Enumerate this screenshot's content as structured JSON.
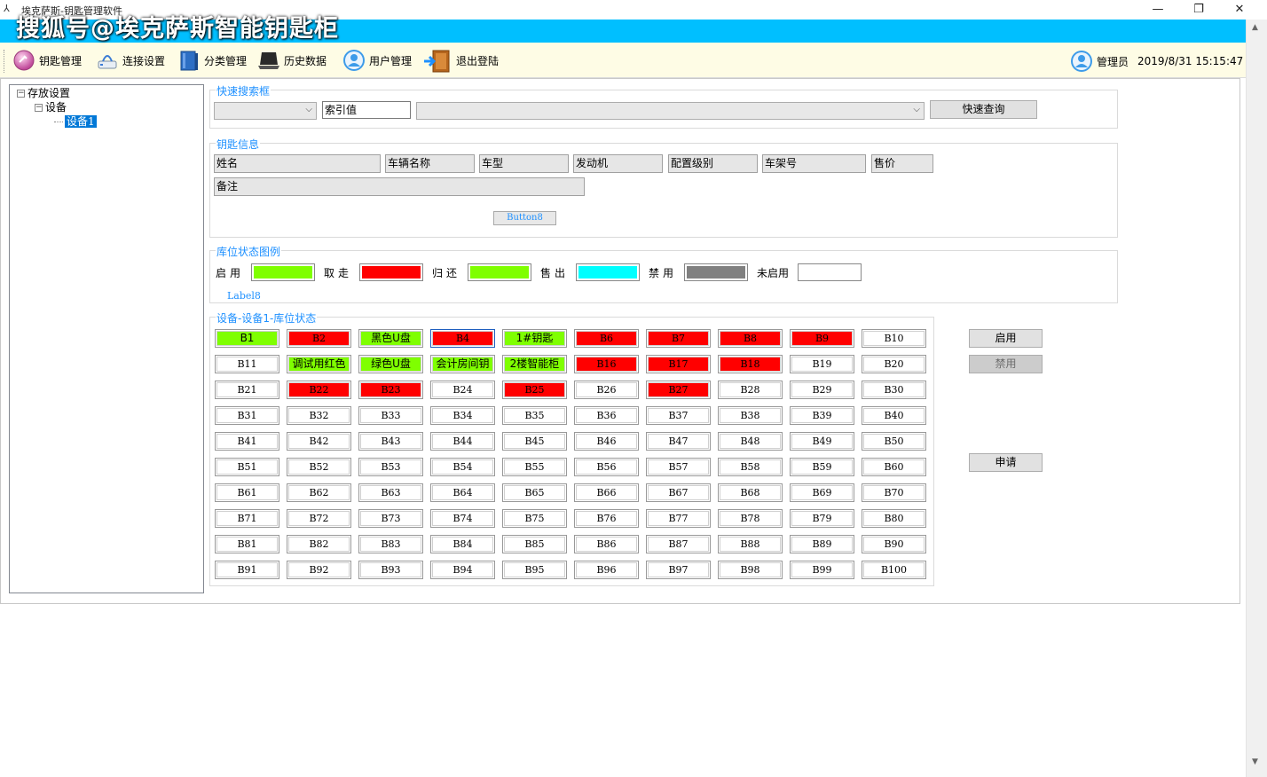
{
  "window": {
    "title": "埃克萨斯-钥匙管理软件",
    "watermark": "搜狐号@埃克萨斯智能钥匙柜",
    "min_glyph": "—",
    "restore_glyph": "❐",
    "close_glyph": "✕",
    "accent_color": "#00bfff"
  },
  "toolbar": {
    "items": [
      {
        "label": "钥匙管理",
        "icon": "key-ball-icon"
      },
      {
        "label": "连接设置",
        "icon": "connection-icon"
      },
      {
        "label": "分类管理",
        "icon": "book-icon"
      },
      {
        "label": "历史数据",
        "icon": "laptop-icon"
      },
      {
        "label": "用户管理",
        "icon": "user-icon"
      },
      {
        "label": "退出登陆",
        "icon": "exit-door-icon"
      }
    ],
    "user_label": "管理员",
    "datetime": "2019/8/31 15:15:47"
  },
  "tree": {
    "root": "存放设置",
    "child": "设备",
    "leaf": "设备1"
  },
  "search": {
    "title": "快速搜索框",
    "index_value": "索引值",
    "button": "快速查询"
  },
  "key_info": {
    "title": "钥匙信息",
    "fields": [
      "姓名",
      "车辆名称",
      "车型",
      "发动机",
      "配置级别",
      "车架号",
      "售价"
    ],
    "remark": "备注",
    "button": "Button8"
  },
  "legend": {
    "title": "库位状态图例",
    "items": [
      {
        "label": "启用",
        "color": "#7fff00"
      },
      {
        "label": "取走",
        "color": "#ff0000"
      },
      {
        "label": "归还",
        "color": "#7fff00"
      },
      {
        "label": "售出",
        "color": "#00ffff"
      },
      {
        "label": "禁用",
        "color": "#808080"
      },
      {
        "label": "未启用",
        "color": "#ffffff"
      }
    ],
    "footer": "Label8"
  },
  "slots": {
    "title": "设备-设备1-库位状态",
    "cells": [
      {
        "label": "B1",
        "status": "green"
      },
      {
        "label": "B2",
        "status": "red"
      },
      {
        "label": "黑色U盘",
        "status": "green"
      },
      {
        "label": "B4",
        "status": "red-focus"
      },
      {
        "label": "1#钥匙",
        "status": "green"
      },
      {
        "label": "B6",
        "status": "red"
      },
      {
        "label": "B7",
        "status": "red"
      },
      {
        "label": "B8",
        "status": "red"
      },
      {
        "label": "B9",
        "status": "red"
      },
      {
        "label": "B10",
        "status": "white"
      },
      {
        "label": "B11",
        "status": "white"
      },
      {
        "label": "调试用红色",
        "status": "green"
      },
      {
        "label": "绿色U盘",
        "status": "green"
      },
      {
        "label": "会计房间钥",
        "status": "green"
      },
      {
        "label": "2楼智能柜",
        "status": "green"
      },
      {
        "label": "B16",
        "status": "red"
      },
      {
        "label": "B17",
        "status": "red"
      },
      {
        "label": "B18",
        "status": "red"
      },
      {
        "label": "B19",
        "status": "white"
      },
      {
        "label": "B20",
        "status": "white"
      },
      {
        "label": "B21",
        "status": "white"
      },
      {
        "label": "B22",
        "status": "red"
      },
      {
        "label": "B23",
        "status": "red"
      },
      {
        "label": "B24",
        "status": "white"
      },
      {
        "label": "B25",
        "status": "red"
      },
      {
        "label": "B26",
        "status": "white"
      },
      {
        "label": "B27",
        "status": "red"
      },
      {
        "label": "B28",
        "status": "white"
      },
      {
        "label": "B29",
        "status": "white"
      },
      {
        "label": "B30",
        "status": "white"
      },
      {
        "label": "B31",
        "status": "white"
      },
      {
        "label": "B32",
        "status": "white"
      },
      {
        "label": "B33",
        "status": "white"
      },
      {
        "label": "B34",
        "status": "white"
      },
      {
        "label": "B35",
        "status": "white"
      },
      {
        "label": "B36",
        "status": "white"
      },
      {
        "label": "B37",
        "status": "white"
      },
      {
        "label": "B38",
        "status": "white"
      },
      {
        "label": "B39",
        "status": "white"
      },
      {
        "label": "B40",
        "status": "white"
      },
      {
        "label": "B41",
        "status": "white"
      },
      {
        "label": "B42",
        "status": "white"
      },
      {
        "label": "B43",
        "status": "white"
      },
      {
        "label": "B44",
        "status": "white"
      },
      {
        "label": "B45",
        "status": "white"
      },
      {
        "label": "B46",
        "status": "white"
      },
      {
        "label": "B47",
        "status": "white"
      },
      {
        "label": "B48",
        "status": "white"
      },
      {
        "label": "B49",
        "status": "white"
      },
      {
        "label": "B50",
        "status": "white"
      },
      {
        "label": "B51",
        "status": "white"
      },
      {
        "label": "B52",
        "status": "white"
      },
      {
        "label": "B53",
        "status": "white"
      },
      {
        "label": "B54",
        "status": "white"
      },
      {
        "label": "B55",
        "status": "white"
      },
      {
        "label": "B56",
        "status": "white"
      },
      {
        "label": "B57",
        "status": "white"
      },
      {
        "label": "B58",
        "status": "white"
      },
      {
        "label": "B59",
        "status": "white"
      },
      {
        "label": "B60",
        "status": "white"
      },
      {
        "label": "B61",
        "status": "white"
      },
      {
        "label": "B62",
        "status": "white"
      },
      {
        "label": "B63",
        "status": "white"
      },
      {
        "label": "B64",
        "status": "white"
      },
      {
        "label": "B65",
        "status": "white"
      },
      {
        "label": "B66",
        "status": "white"
      },
      {
        "label": "B67",
        "status": "white"
      },
      {
        "label": "B68",
        "status": "white"
      },
      {
        "label": "B69",
        "status": "white"
      },
      {
        "label": "B70",
        "status": "white"
      },
      {
        "label": "B71",
        "status": "white"
      },
      {
        "label": "B72",
        "status": "white"
      },
      {
        "label": "B73",
        "status": "white"
      },
      {
        "label": "B74",
        "status": "white"
      },
      {
        "label": "B75",
        "status": "white"
      },
      {
        "label": "B76",
        "status": "white"
      },
      {
        "label": "B77",
        "status": "white"
      },
      {
        "label": "B78",
        "status": "white"
      },
      {
        "label": "B79",
        "status": "white"
      },
      {
        "label": "B80",
        "status": "white"
      },
      {
        "label": "B81",
        "status": "white"
      },
      {
        "label": "B82",
        "status": "white"
      },
      {
        "label": "B83",
        "status": "white"
      },
      {
        "label": "B84",
        "status": "white"
      },
      {
        "label": "B85",
        "status": "white"
      },
      {
        "label": "B86",
        "status": "white"
      },
      {
        "label": "B87",
        "status": "white"
      },
      {
        "label": "B88",
        "status": "white"
      },
      {
        "label": "B89",
        "status": "white"
      },
      {
        "label": "B90",
        "status": "white"
      },
      {
        "label": "B91",
        "status": "white"
      },
      {
        "label": "B92",
        "status": "white"
      },
      {
        "label": "B93",
        "status": "white"
      },
      {
        "label": "B94",
        "status": "white"
      },
      {
        "label": "B95",
        "status": "white"
      },
      {
        "label": "B96",
        "status": "white"
      },
      {
        "label": "B97",
        "status": "white"
      },
      {
        "label": "B98",
        "status": "white"
      },
      {
        "label": "B99",
        "status": "white"
      },
      {
        "label": "B100",
        "status": "white"
      }
    ]
  },
  "actions": {
    "enable": "启用",
    "disable": "禁用",
    "apply": "申请"
  }
}
